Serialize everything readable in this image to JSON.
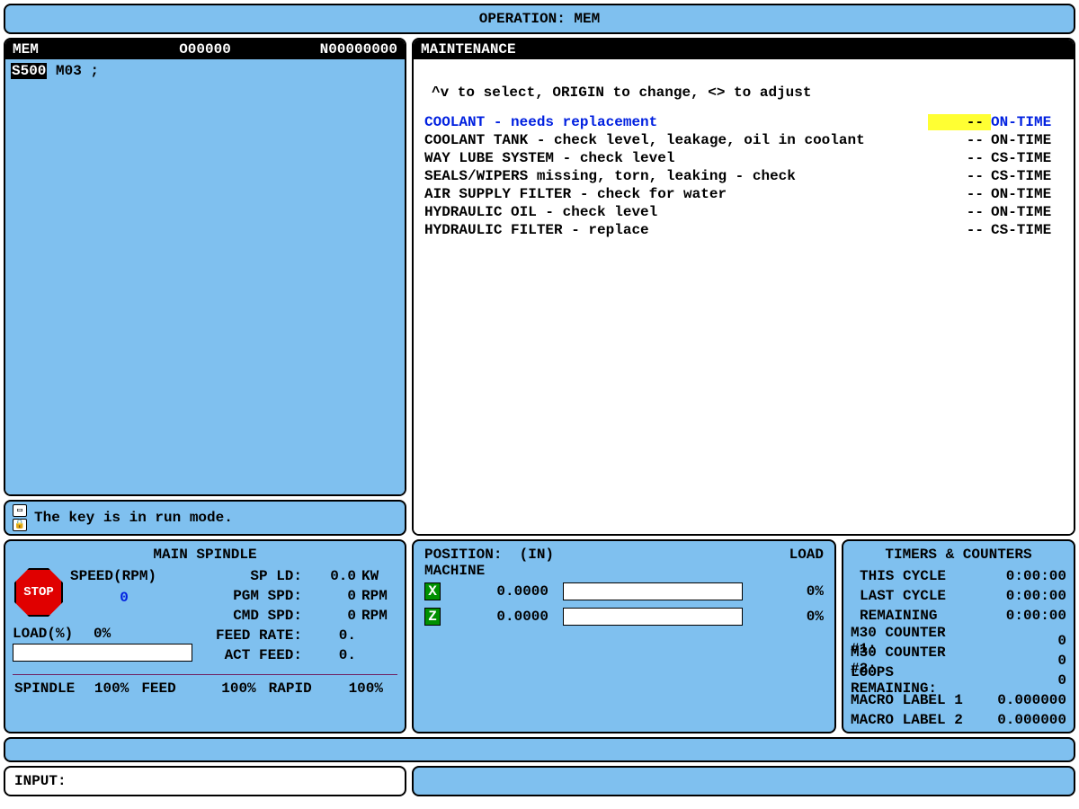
{
  "header": {
    "title": "OPERATION: MEM"
  },
  "program": {
    "mode": "MEM",
    "onum": "O00000",
    "nnum": "N00000000",
    "line_hl": "S500",
    "line_rest": " M03 ;"
  },
  "message": {
    "text": "The key is in run mode."
  },
  "maintenance": {
    "title": "MAINTENANCE",
    "instructions": "^v to select, ORIGIN to change, <> to adjust",
    "items": [
      {
        "desc": "COOLANT - needs replacement",
        "dash": "--",
        "time": "ON-TIME",
        "selected": true
      },
      {
        "desc": "COOLANT TANK - check level, leakage, oil in coolant",
        "dash": "--",
        "time": "ON-TIME"
      },
      {
        "desc": "WAY LUBE SYSTEM - check level",
        "dash": "--",
        "time": "CS-TIME"
      },
      {
        "desc": "SEALS/WIPERS missing, torn, leaking - check",
        "dash": "--",
        "time": "CS-TIME"
      },
      {
        "desc": "AIR SUPPLY FILTER - check for water",
        "dash": "--",
        "time": "ON-TIME"
      },
      {
        "desc": "HYDRAULIC OIL - check level",
        "dash": "--",
        "time": "ON-TIME"
      },
      {
        "desc": "HYDRAULIC FILTER - replace",
        "dash": "--",
        "time": "CS-TIME"
      }
    ]
  },
  "spindle": {
    "title": "MAIN SPINDLE",
    "stop": "STOP",
    "speed_label": "SPEED(RPM)",
    "zero": "0",
    "rows": [
      {
        "lab": "SP LD:",
        "val": "0.0",
        "unit": "KW"
      },
      {
        "lab": "PGM SPD:",
        "val": "0",
        "unit": "RPM"
      },
      {
        "lab": "CMD SPD:",
        "val": "0",
        "unit": "RPM"
      },
      {
        "lab": "FEED RATE:",
        "val": "0.",
        "unit": ""
      },
      {
        "lab": "ACT FEED:",
        "val": "0.",
        "unit": ""
      }
    ],
    "load_label": "LOAD(%)",
    "load_val": "0%",
    "overrides": {
      "spindle_lab": "SPINDLE",
      "spindle_val": "100%",
      "feed_lab": "FEED",
      "feed_val": "100%",
      "rapid_lab": "RAPID",
      "rapid_val": "100%"
    }
  },
  "position": {
    "title": "POSITION:",
    "units": "(IN)",
    "load": "LOAD",
    "subtitle": "MACHINE",
    "axes": [
      {
        "name": "X",
        "val": "0.0000",
        "pct": "0%"
      },
      {
        "name": "Z",
        "val": "0.0000",
        "pct": "0%"
      }
    ]
  },
  "timers": {
    "title": "TIMERS & COUNTERS",
    "rows1": [
      {
        "lab": "THIS CYCLE",
        "val": "0:00:00"
      },
      {
        "lab": "LAST CYCLE",
        "val": "0:00:00"
      },
      {
        "lab": "REMAINING",
        "val": "0:00:00"
      }
    ],
    "rows2": [
      {
        "lab": "M30 COUNTER #1:",
        "val": "0"
      },
      {
        "lab": "M30 COUNTER #2:",
        "val": "0"
      },
      {
        "lab": "LOOPS REMAINING:",
        "val": "0"
      },
      {
        "lab": "MACRO LABEL 1",
        "val": "0.000000"
      },
      {
        "lab": "MACRO LABEL 2",
        "val": "0.000000"
      }
    ]
  },
  "input": {
    "label": "INPUT:"
  }
}
